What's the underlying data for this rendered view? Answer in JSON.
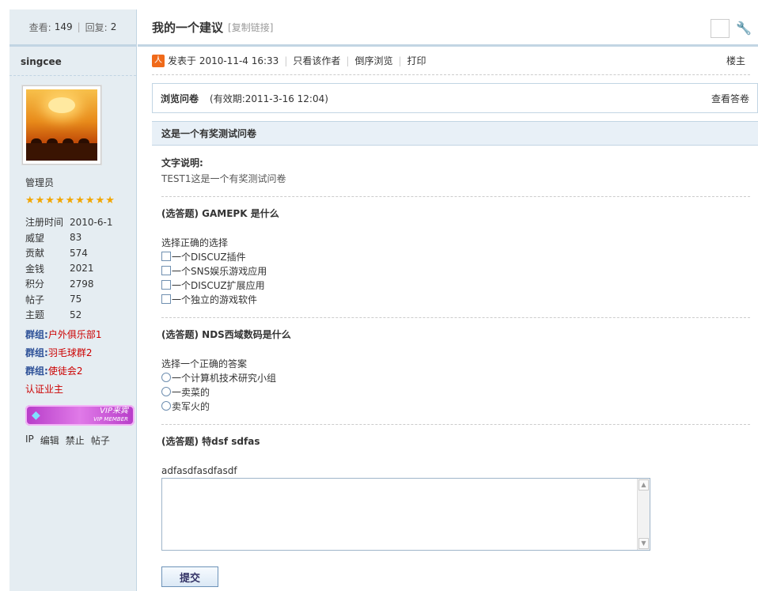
{
  "sidebar": {
    "views_label": "查看:",
    "views_value": "149",
    "replies_label": "回复:",
    "replies_value": "2",
    "username": "singcee",
    "role": "管理员",
    "stars": "★★★★★★★★★",
    "stats": [
      {
        "k": "注册时间",
        "v": "2010-6-1"
      },
      {
        "k": "威望",
        "v": "83"
      },
      {
        "k": "贡献",
        "v": "574"
      },
      {
        "k": "金钱",
        "v": "2021"
      },
      {
        "k": "积分",
        "v": "2798"
      },
      {
        "k": "帖子",
        "v": "75"
      },
      {
        "k": "主题",
        "v": "52"
      }
    ],
    "groups": [
      {
        "k": "群组:",
        "v": "户外俱乐部1"
      },
      {
        "k": "群组:",
        "v": "羽毛球群2"
      },
      {
        "k": "群组:",
        "v": "使徒会2"
      }
    ],
    "cert": "认证业主",
    "vip": {
      "line1": "VIP来宾",
      "line2": "VIP MEMBER"
    },
    "admin_links": [
      "IP",
      "编辑",
      "禁止",
      "帖子"
    ]
  },
  "header": {
    "title": "我的一个建议",
    "copy_link": "[复制链接]"
  },
  "postinfo": {
    "posted": "发表于 2010-11-4 16:33",
    "only_author": "只看该作者",
    "reverse": "倒序浏览",
    "print": "打印",
    "floor": "楼主"
  },
  "survey": {
    "heading": "浏览问卷",
    "valid": "(有效期:2011-3-16 12:04)",
    "view_answers": "查看答卷",
    "title": "这是一个有奖测试问卷",
    "desc_label": "文字说明:",
    "desc_text": "TEST1这是一个有奖测试问卷",
    "q1": {
      "title": "(选答题) GAMEPK 是什么",
      "prompt": "选择正确的选择",
      "options": [
        "一个DISCUZ插件",
        "一个SNS娱乐游戏应用",
        "一个DISCUZ扩展应用",
        "一个独立的游戏软件"
      ]
    },
    "q2": {
      "title": "(选答题) NDS西域数码是什么",
      "prompt": "选择一个正确的答案",
      "options": [
        "一个计算机技术研究小组",
        "一卖菜的",
        "卖军火的"
      ]
    },
    "q3": {
      "title": "(选答题) 特dsf sdfas",
      "prompt": "adfasdfasdfasdf",
      "value": ""
    },
    "submit": "提交"
  }
}
